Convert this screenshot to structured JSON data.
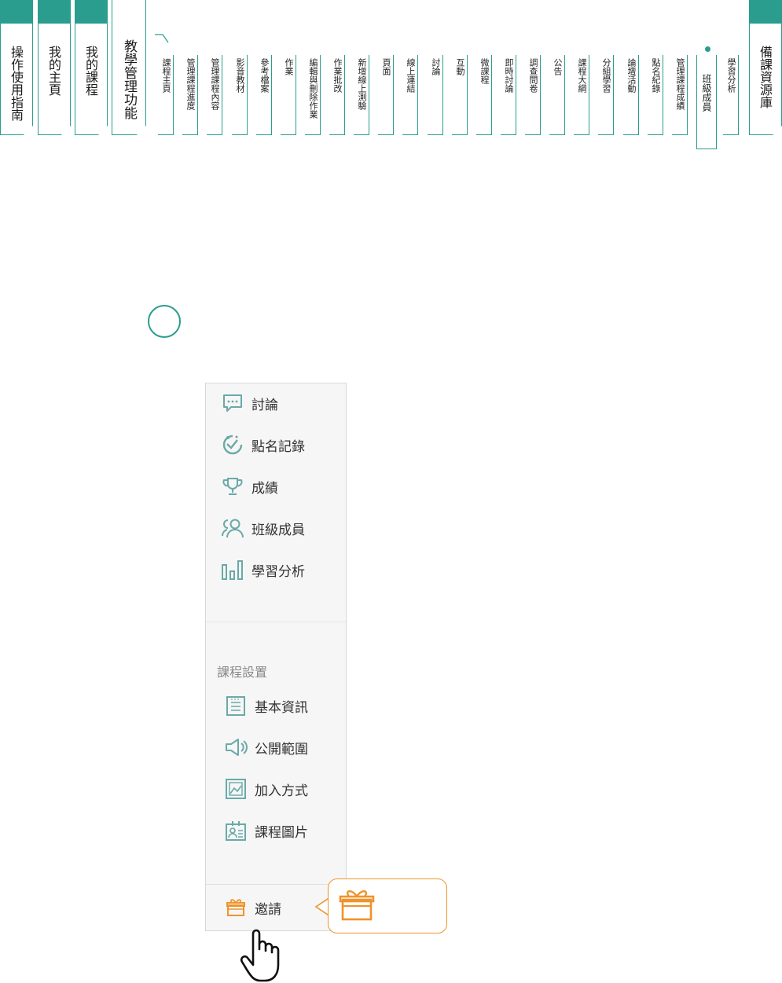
{
  "nav": {
    "main_tabs": [
      {
        "label": "操作使用指南"
      },
      {
        "label": "我的主頁"
      },
      {
        "label": "我的課程"
      },
      {
        "label": "教學管理功能"
      },
      {
        "label": "備課資源庫"
      }
    ],
    "sub_items": [
      "課程主頁",
      "管理課程進度",
      "管理課程內容",
      "影音教材",
      "參考檔案",
      "作業",
      "編輯與刪除作業",
      "作業批改",
      "新增線上測驗",
      "頁面",
      "線上連結",
      "討論",
      "互動",
      "微課程",
      "即時討論",
      "調查問卷",
      "公告",
      "課程大綱",
      "分組學習",
      "論壇活動",
      "點名紀錄",
      "管理課程成績",
      "班級成員",
      "學習分析"
    ],
    "active_sub": "班級成員",
    "accent_color": "#2a9d8f"
  },
  "menu": {
    "items": [
      {
        "label": "討論",
        "icon": "chat-bubble-icon"
      },
      {
        "label": "點名記錄",
        "icon": "attendance-icon"
      },
      {
        "label": "成績",
        "icon": "trophy-icon"
      },
      {
        "label": "班級成員",
        "icon": "members-icon"
      },
      {
        "label": "學習分析",
        "icon": "bar-chart-icon"
      }
    ],
    "section_title": "課程設置",
    "settings": [
      {
        "label": "基本資訊",
        "icon": "info-list-icon"
      },
      {
        "label": "公開範圍",
        "icon": "megaphone-icon"
      },
      {
        "label": "加入方式",
        "icon": "image-frame-icon"
      },
      {
        "label": "課程圖片",
        "icon": "id-card-icon"
      }
    ],
    "invite": {
      "label": "邀請",
      "icon": "gift-icon",
      "color": "#f0932b"
    }
  }
}
